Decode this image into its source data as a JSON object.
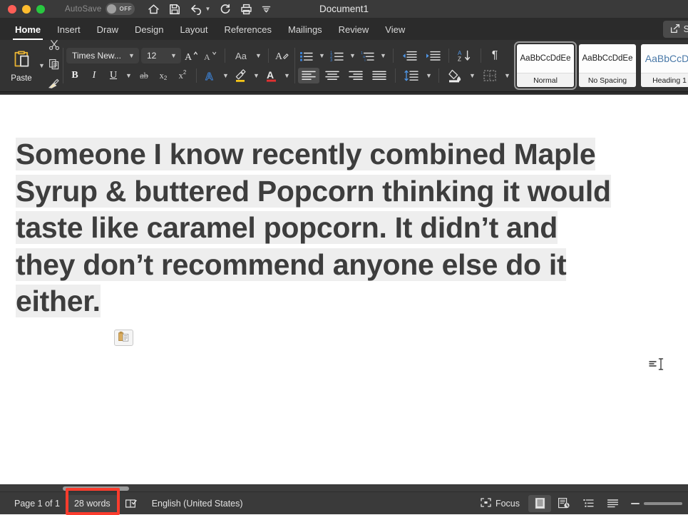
{
  "window": {
    "title": "Document1",
    "autosave": {
      "label": "AutoSave",
      "state": "OFF"
    },
    "traffic_lights": [
      "close-red",
      "minimize-yellow",
      "maximize-green"
    ],
    "quick_access": [
      "home-icon",
      "save-icon",
      "undo-icon",
      "undo-dropdown-chevron",
      "redo-icon",
      "print-icon",
      "customize-toolbar-icon"
    ]
  },
  "tabs": [
    {
      "label": "Home",
      "active": true
    },
    {
      "label": "Insert",
      "active": false
    },
    {
      "label": "Draw",
      "active": false
    },
    {
      "label": "Design",
      "active": false
    },
    {
      "label": "Layout",
      "active": false
    },
    {
      "label": "References",
      "active": false
    },
    {
      "label": "Mailings",
      "active": false
    },
    {
      "label": "Review",
      "active": false
    },
    {
      "label": "View",
      "active": false
    }
  ],
  "share": {
    "label": "S",
    "icon": "share-icon"
  },
  "ribbon": {
    "clipboard": {
      "paste_label": "Paste",
      "paste_icon": "clipboard-icon",
      "cut_icon": "scissors-icon",
      "copy_icon": "copy-icon",
      "format_painter_icon": "paintbrush-icon"
    },
    "font": {
      "family_value": "Times New...",
      "size_value": "12",
      "grow_font_icon": "increase-font-size-icon",
      "shrink_font_icon": "decrease-font-size-icon",
      "change_case_label": "Aa",
      "clear_formatting_icon": "clear-formatting-icon",
      "bold_label": "B",
      "italic_label": "I",
      "underline_label": "U",
      "strikethrough_label": "ab",
      "subscript_label": "x",
      "superscript_label": "x",
      "text_effects_icon": "text-effects-icon",
      "highlight_icon": "text-highlight-color-icon",
      "highlight_color": "#f5c518",
      "font_color_icon": "font-color-icon",
      "font_color": "#e03131"
    },
    "paragraph": {
      "bullets_icon": "bulleted-list-icon",
      "numbering_icon": "numbered-list-icon",
      "multilevel_icon": "multilevel-list-icon",
      "decrease_indent_icon": "decrease-indent-icon",
      "increase_indent_icon": "increase-indent-icon",
      "sort_icon": "sort-az-icon",
      "show_marks_label": "¶",
      "align_left_icon": "align-left-icon",
      "align_center_icon": "align-center-icon",
      "align_right_icon": "align-right-icon",
      "justify_icon": "justify-icon",
      "line_spacing_icon": "line-spacing-icon",
      "shading_icon": "shading-icon",
      "borders_icon": "borders-icon",
      "accent_color": "#3c82d6"
    },
    "styles": [
      {
        "preview": "AaBbCcDdEe",
        "name": "Normal",
        "selected": true,
        "heading": false
      },
      {
        "preview": "AaBbCcDdEe",
        "name": "No Spacing",
        "selected": false,
        "heading": false
      },
      {
        "preview": "AaBbCcDc",
        "name": "Heading 1",
        "selected": false,
        "heading": true
      }
    ]
  },
  "document": {
    "lines": [
      "Someone I know recently combined Maple",
      "Syrup & buttered Popcorn thinking it would",
      "taste like caramel popcorn. It didn’t and",
      "they don’t recommend anyone else do it",
      "either."
    ],
    "selection_highlight_color": "#eeeeee",
    "text_color": "#3d3d3d",
    "paste_options_icon": "paste-options-clipboard-icon",
    "cursor_icon": "i-beam-text-cursor"
  },
  "status": {
    "page": "Page 1 of 1",
    "words": "28 words",
    "proofing_icon": "proofing-errors-icon",
    "language": "English (United States)",
    "focus_label": "Focus",
    "focus_icon": "focus-mode-icon",
    "views": [
      {
        "icon": "print-layout-view-icon",
        "active": true
      },
      {
        "icon": "web-layout-view-icon",
        "active": false
      },
      {
        "icon": "outline-view-icon",
        "active": false
      },
      {
        "icon": "draft-view-icon",
        "active": false
      }
    ],
    "zoom_out_icon": "zoom-out-icon",
    "annotation_color": "#fb3c2d"
  }
}
